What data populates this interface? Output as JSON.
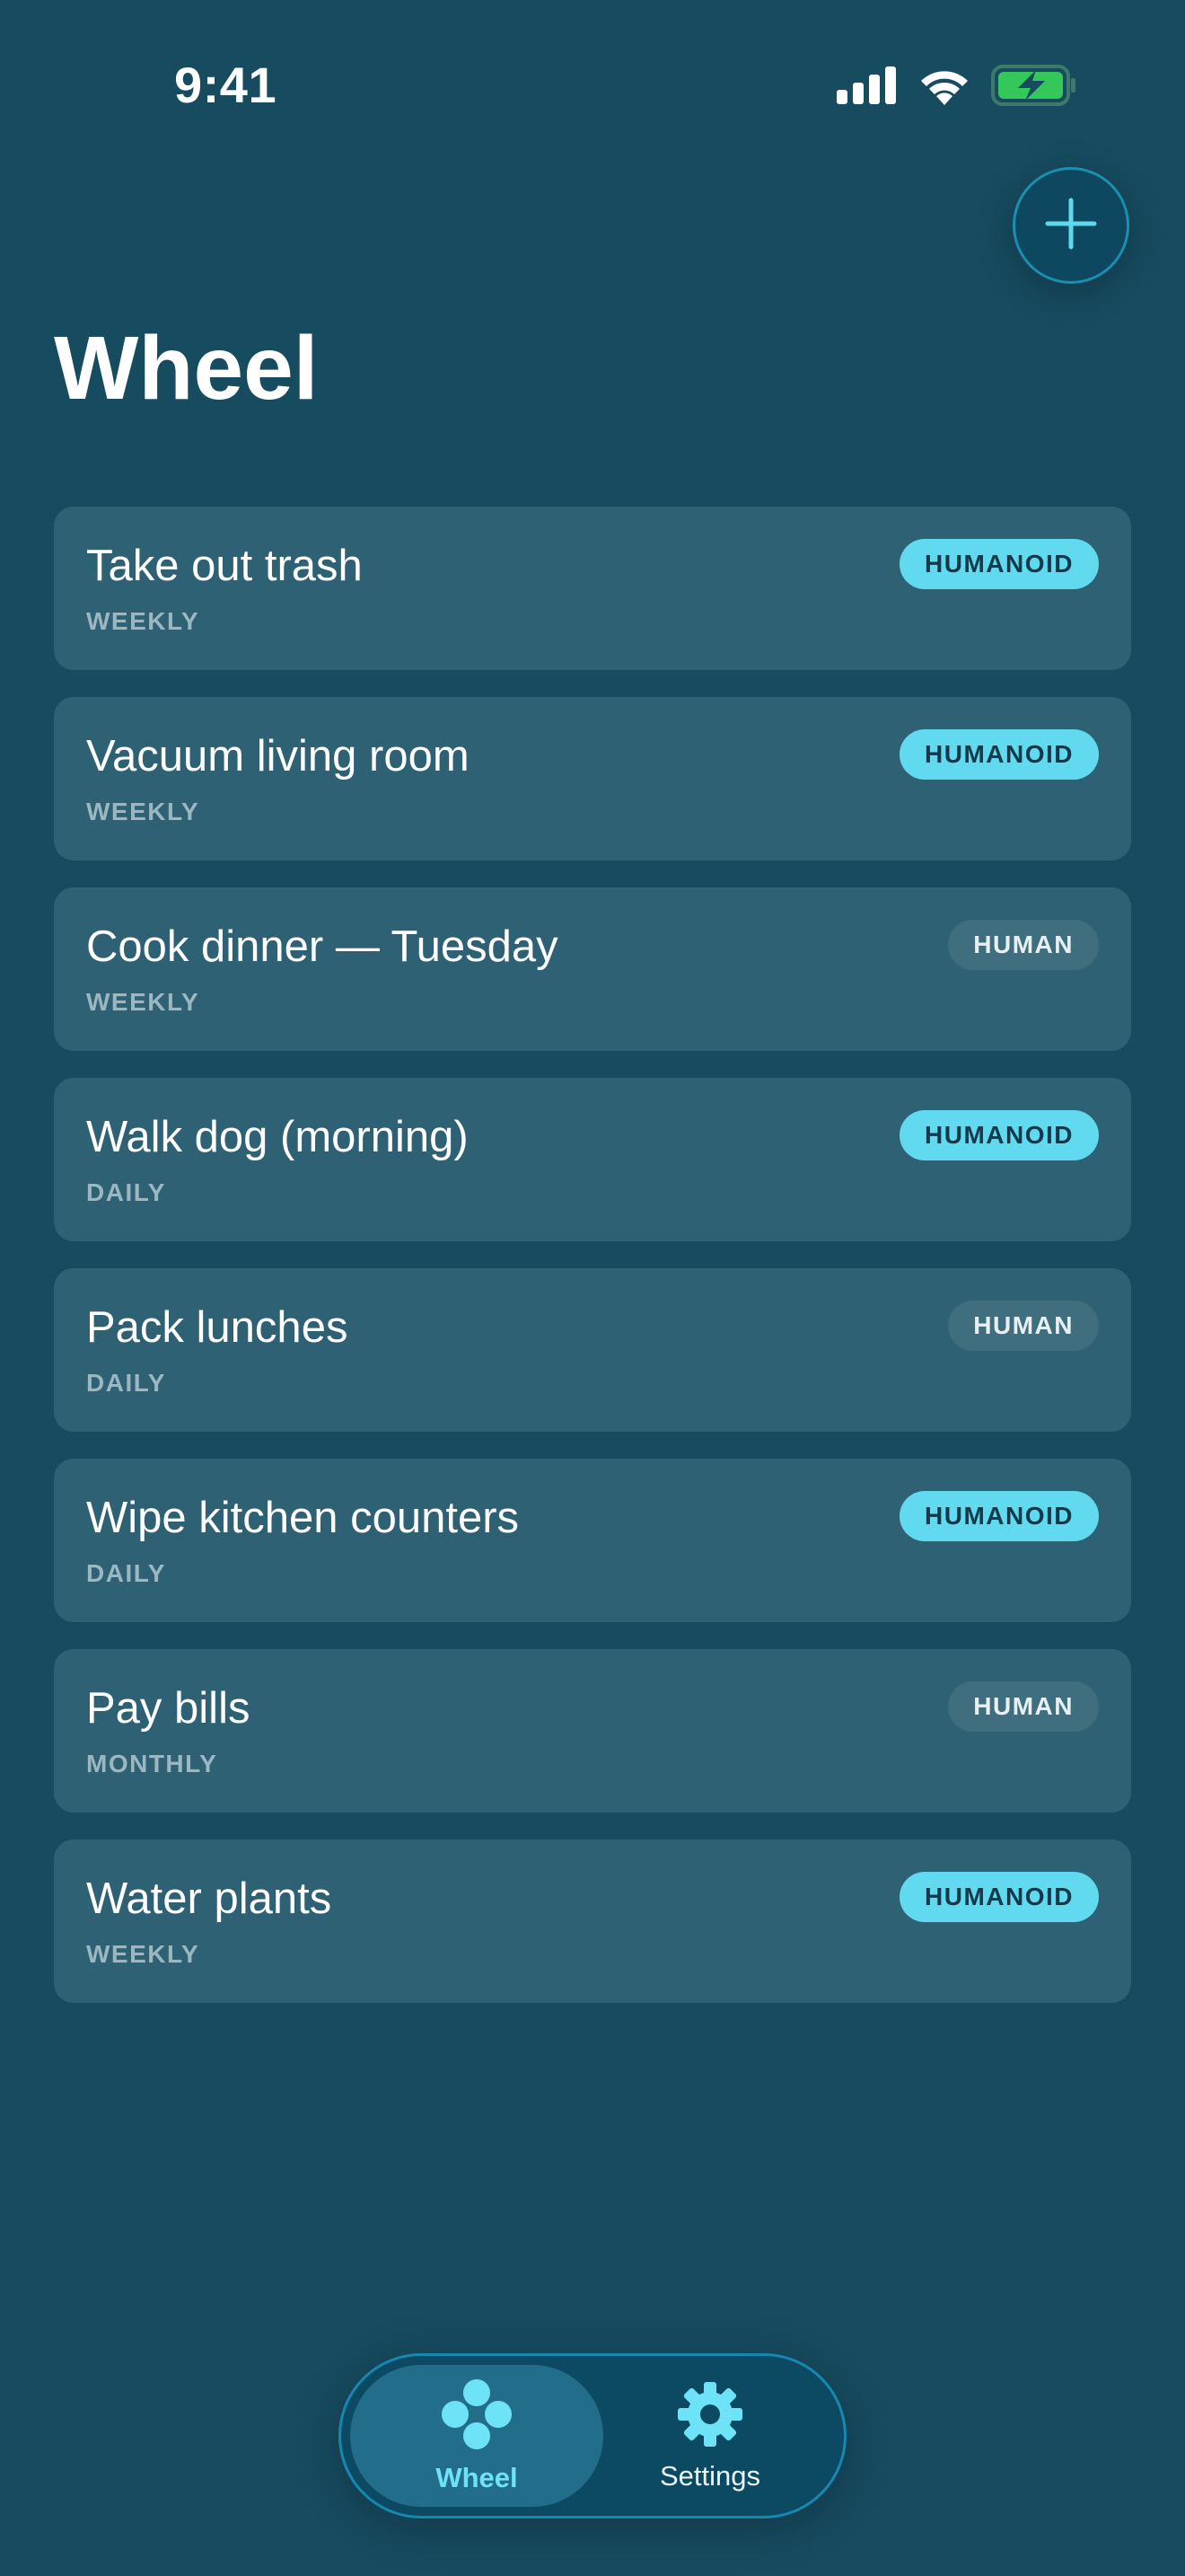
{
  "status_bar": {
    "time": "9:41"
  },
  "header": {
    "title": "Wheel",
    "add_icon": "plus-icon"
  },
  "tasks": [
    {
      "title": "Take out trash",
      "frequency": "WEEKLY",
      "assignee": "HUMANOID"
    },
    {
      "title": "Vacuum living room",
      "frequency": "WEEKLY",
      "assignee": "HUMANOID"
    },
    {
      "title": "Cook dinner — Tuesday",
      "frequency": "WEEKLY",
      "assignee": "HUMAN"
    },
    {
      "title": "Walk dog (morning)",
      "frequency": "DAILY",
      "assignee": "HUMANOID"
    },
    {
      "title": "Pack lunches",
      "frequency": "DAILY",
      "assignee": "HUMAN"
    },
    {
      "title": "Wipe kitchen counters",
      "frequency": "DAILY",
      "assignee": "HUMANOID"
    },
    {
      "title": "Pay bills",
      "frequency": "MONTHLY",
      "assignee": "HUMAN"
    },
    {
      "title": "Water plants",
      "frequency": "WEEKLY",
      "assignee": "HUMANOID"
    }
  ],
  "tab_bar": {
    "tabs": [
      {
        "label": "Wheel",
        "icon": "wheel-dots-icon",
        "selected": true
      },
      {
        "label": "Settings",
        "icon": "gear-icon",
        "selected": false
      }
    ]
  },
  "colors": {
    "background": "#174b60",
    "card": "#2d6173",
    "accent": "#61daf0",
    "human_badge": "#3f6f7f",
    "battery": "#34c759"
  }
}
